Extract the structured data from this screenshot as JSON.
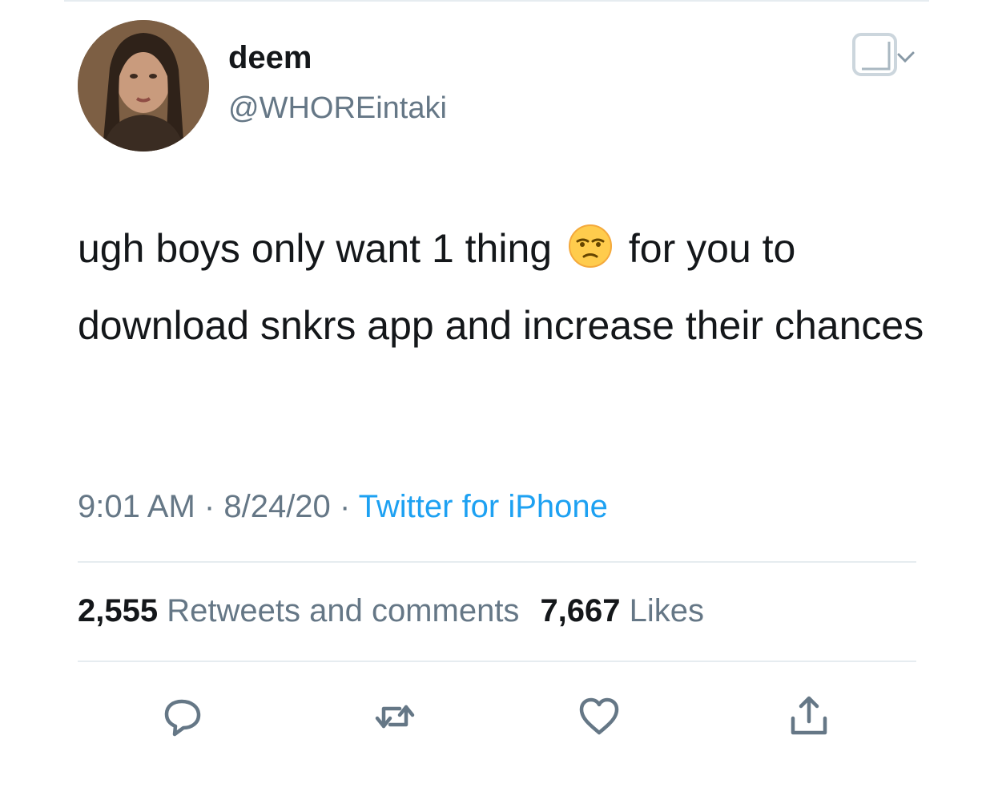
{
  "tweet": {
    "display_name": "deem",
    "handle": "@WHOREintaki",
    "text_before_emoji": "ugh boys only want 1 thing",
    "emoji_icon": "unamused-face-emoji",
    "text_after_emoji": "for you to download snkrs app and increase their chances",
    "time": "9:01 AM",
    "separator": "·",
    "date": "8/24/20",
    "source": "Twitter for iPhone"
  },
  "stats": {
    "retweets_count": "2,555",
    "retweets_label": "Retweets and comments",
    "likes_count": "7,667",
    "likes_label": "Likes"
  },
  "actions": {
    "reply_icon": "reply-icon",
    "retweet_icon": "retweet-icon",
    "like_icon": "heart-icon",
    "share_icon": "share-icon"
  },
  "colors": {
    "text": "#14171a",
    "secondary": "#657786",
    "link": "#1da1f2",
    "divider": "#e6ecf0"
  }
}
